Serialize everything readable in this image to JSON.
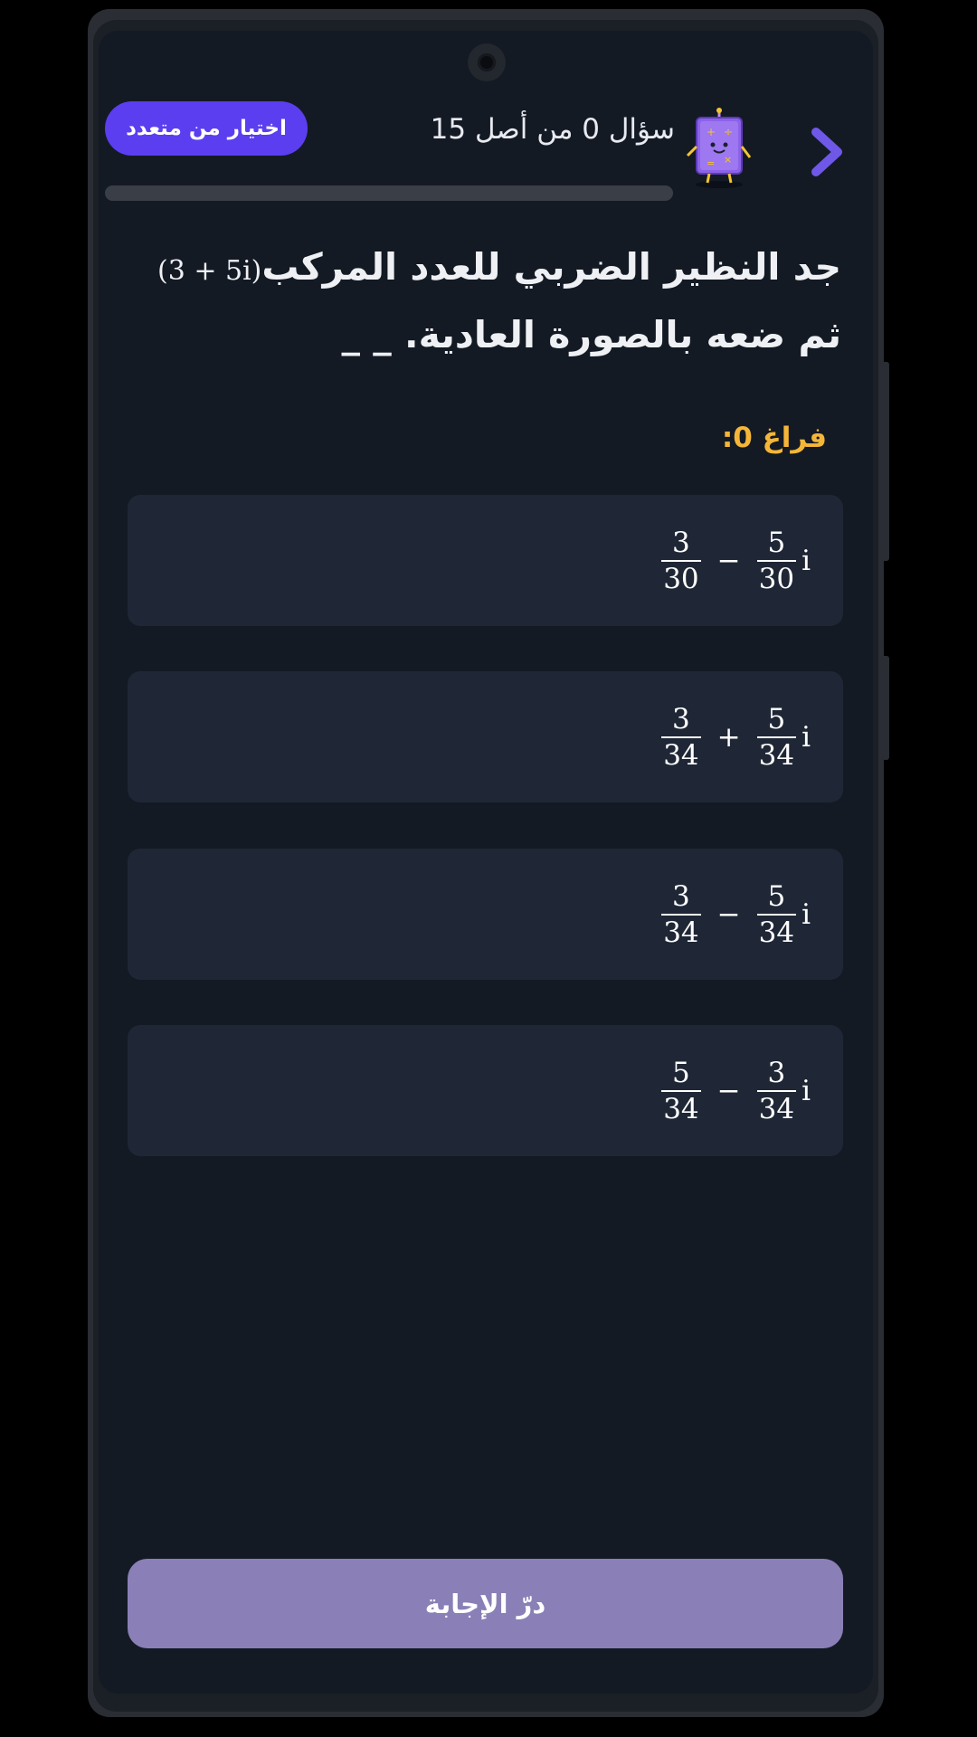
{
  "header": {
    "type_label": "اختيار من متعدد",
    "counter": "سؤال 0 من أصل 15",
    "progress": 0
  },
  "question": {
    "text_before": "جد النظير الضربي للعدد المركب",
    "math": "(3 + 5i)",
    "text_after": " ثم ضعه بالصورة العادية. _ _"
  },
  "blank_label": "فراغ 0:",
  "options": [
    {
      "a_num": "3",
      "a_den": "30",
      "op": "−",
      "b_num": "5",
      "b_den": "30",
      "unit": "i"
    },
    {
      "a_num": "3",
      "a_den": "34",
      "op": "+",
      "b_num": "5",
      "b_den": "34",
      "unit": "i"
    },
    {
      "a_num": "3",
      "a_den": "34",
      "op": "−",
      "b_num": "5",
      "b_den": "34",
      "unit": "i"
    },
    {
      "a_num": "5",
      "a_den": "34",
      "op": "−",
      "b_num": "3",
      "b_den": "34",
      "unit": "i"
    }
  ],
  "submit_label": "درّ الإجابة",
  "icons": {
    "mascot": "calculator-mascot-icon",
    "next": "chevron-right-icon",
    "camera": "camera-icon"
  },
  "colors": {
    "background": "#131a24",
    "accent": "#5b3ef0",
    "option_bg": "#1f2736",
    "blank_label": "#f5b638",
    "submit": "#8a80b7"
  }
}
